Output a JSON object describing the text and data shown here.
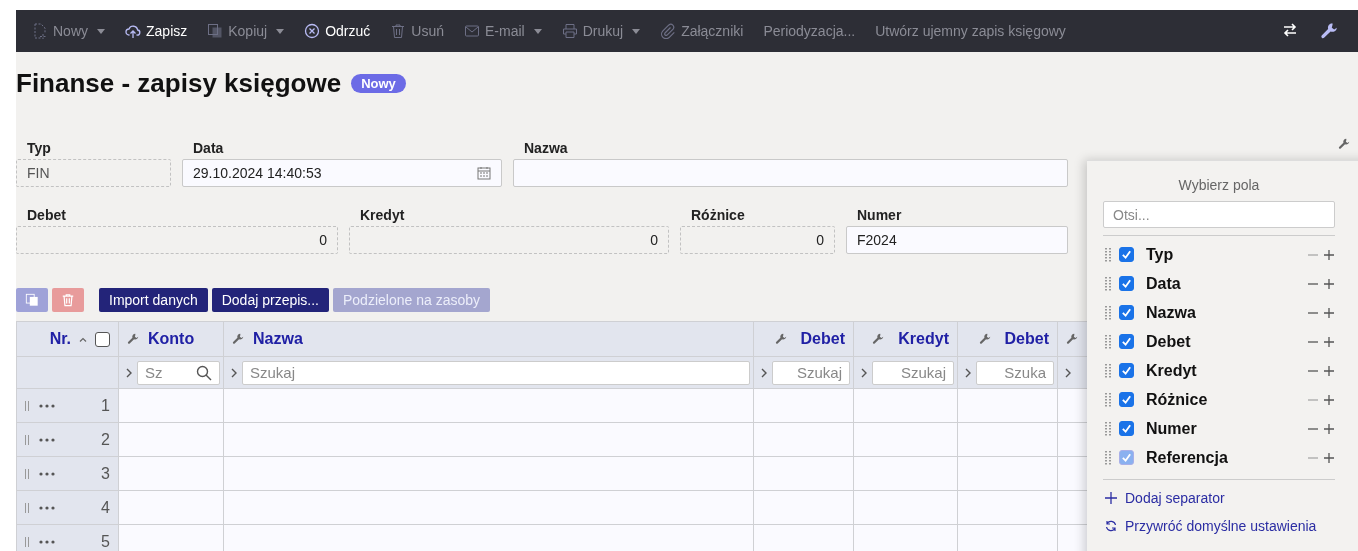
{
  "toolbar": {
    "items": [
      {
        "label": "Nowy",
        "dropdown": true,
        "disabled": true
      },
      {
        "label": "Zapisz",
        "dropdown": false,
        "disabled": false
      },
      {
        "label": "Kopiuj",
        "dropdown": true,
        "disabled": true
      },
      {
        "label": "Odrzuć",
        "dropdown": false,
        "disabled": false
      },
      {
        "label": "Usuń",
        "dropdown": false,
        "disabled": true
      },
      {
        "label": "E-mail",
        "dropdown": true,
        "disabled": true
      },
      {
        "label": "Drukuj",
        "dropdown": true,
        "disabled": true
      },
      {
        "label": "Załączniki",
        "dropdown": false,
        "disabled": true
      },
      {
        "label": "Periodyzacja...",
        "dropdown": false,
        "disabled": true
      },
      {
        "label": "Utwórz ujemny zapis księgowy",
        "dropdown": false,
        "disabled": true
      }
    ]
  },
  "title": "Finanse - zapisy księgowe",
  "badge": "Nowy",
  "form": {
    "fields": [
      {
        "label": "Typ",
        "value": "FIN",
        "kind": "readonly"
      },
      {
        "label": "Data",
        "value": "29.10.2024 14:40:53",
        "kind": "date"
      },
      {
        "label": "Nazwa",
        "kind": "text"
      },
      {
        "label": "Debet",
        "value": "0",
        "kind": "number"
      },
      {
        "label": "Kredyt",
        "value": "0",
        "kind": "number"
      },
      {
        "label": "Różnice",
        "value": "0",
        "kind": "number"
      },
      {
        "label": "Numer",
        "value": "F2024",
        "kind": "text"
      }
    ]
  },
  "actions": {
    "icon_buttons": [
      {
        "kind": "copy",
        "disabled": true
      },
      {
        "kind": "delete",
        "disabled": true
      }
    ],
    "buttons": [
      {
        "label": "Import danych",
        "disabled": false
      },
      {
        "label": "Dodaj przepis...",
        "disabled": false
      },
      {
        "label": "Podzielone na zasoby",
        "disabled": true
      }
    ]
  },
  "table": {
    "select_all": {
      "checked": false
    },
    "columns": [
      {
        "label": "Nr.",
        "kind": "index"
      },
      {
        "label": "Konto",
        "kind": "search",
        "placeholder": "Sz"
      },
      {
        "label": "Nazwa",
        "kind": "text",
        "placeholder": "Szukaj"
      },
      {
        "label": "Debet",
        "kind": "number",
        "placeholder": "Szukaj"
      },
      {
        "label": "Kredyt",
        "kind": "number",
        "placeholder": "Szukaj"
      },
      {
        "label": "Debet",
        "kind": "number",
        "placeholder": "Szuka"
      }
    ],
    "rows": [
      {
        "nr": "1"
      },
      {
        "nr": "2"
      },
      {
        "nr": "3"
      },
      {
        "nr": "4"
      },
      {
        "nr": "5"
      }
    ]
  },
  "field_picker": {
    "title": "Wybierz pola",
    "search_placeholder": "Otsi...",
    "items": [
      {
        "label": "Typ",
        "checked": true,
        "disabled": false,
        "remove_disabled": true
      },
      {
        "label": "Data",
        "checked": true,
        "disabled": false,
        "remove_disabled": false
      },
      {
        "label": "Nazwa",
        "checked": true,
        "disabled": false,
        "remove_disabled": false
      },
      {
        "label": "Debet",
        "checked": true,
        "disabled": false,
        "remove_disabled": false
      },
      {
        "label": "Kredyt",
        "checked": true,
        "disabled": false,
        "remove_disabled": false
      },
      {
        "label": "Różnice",
        "checked": true,
        "disabled": false,
        "remove_disabled": true
      },
      {
        "label": "Numer",
        "checked": true,
        "disabled": false,
        "remove_disabled": false
      },
      {
        "label": "Referencja",
        "checked": true,
        "disabled": true,
        "remove_disabled": true
      }
    ],
    "add_separator": "Dodaj separator",
    "reset": "Przywróć domyślne ustawienia"
  }
}
